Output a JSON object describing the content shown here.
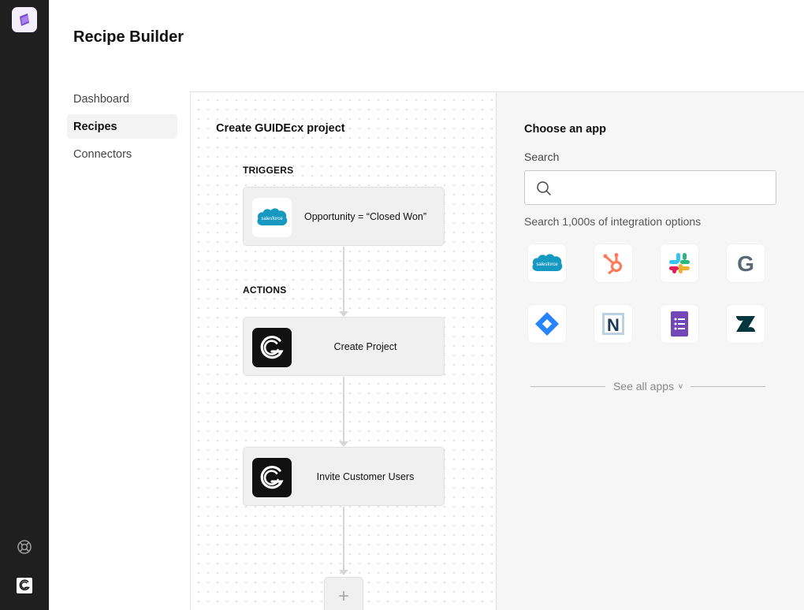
{
  "page": {
    "title": "Recipe Builder"
  },
  "nav": {
    "items": [
      {
        "label": "Dashboard",
        "active": false
      },
      {
        "label": "Recipes",
        "active": true
      },
      {
        "label": "Connectors",
        "active": false
      }
    ]
  },
  "canvas": {
    "recipe_name": "Create GUIDEcx project",
    "triggers_label": "TRIGGERS",
    "actions_label": "ACTIONS",
    "trigger_step": {
      "label": "Opportunity = “Closed Won”",
      "app": "salesforce",
      "icon_text": "salesforce"
    },
    "action_steps": [
      {
        "label": "Create Project",
        "app": "guidecx"
      },
      {
        "label": "Invite Customer Users",
        "app": "guidecx"
      }
    ],
    "add_step_symbol": "+"
  },
  "panel": {
    "title": "Choose an app",
    "search_label": "Search",
    "search_value": "",
    "search_placeholder": "",
    "hint": "Search 1,000s of integration options",
    "apps": [
      {
        "name": "salesforce",
        "icon": "salesforce-icon",
        "icon_text": "salesforce"
      },
      {
        "name": "hubspot",
        "icon": "hubspot-icon"
      },
      {
        "name": "slack",
        "icon": "slack-icon"
      },
      {
        "name": "g-app",
        "icon": "g-icon",
        "icon_text": "G"
      },
      {
        "name": "jira",
        "icon": "jira-icon"
      },
      {
        "name": "netsuite",
        "icon": "netsuite-icon",
        "icon_text": "N"
      },
      {
        "name": "google-forms",
        "icon": "google-forms-icon"
      },
      {
        "name": "zendesk",
        "icon": "zendesk-icon"
      }
    ],
    "see_all_label": "See all apps",
    "see_all_chevron": "v"
  },
  "colors": {
    "rail": "#1f1f1f",
    "salesforce": "#1798c1",
    "hubspot": "#ff7a59",
    "jira": "#2684ff",
    "netsuite": "#1b3a57",
    "forms": "#7248b9",
    "zendesk": "#03363d",
    "g_app": "#5a6a75"
  }
}
